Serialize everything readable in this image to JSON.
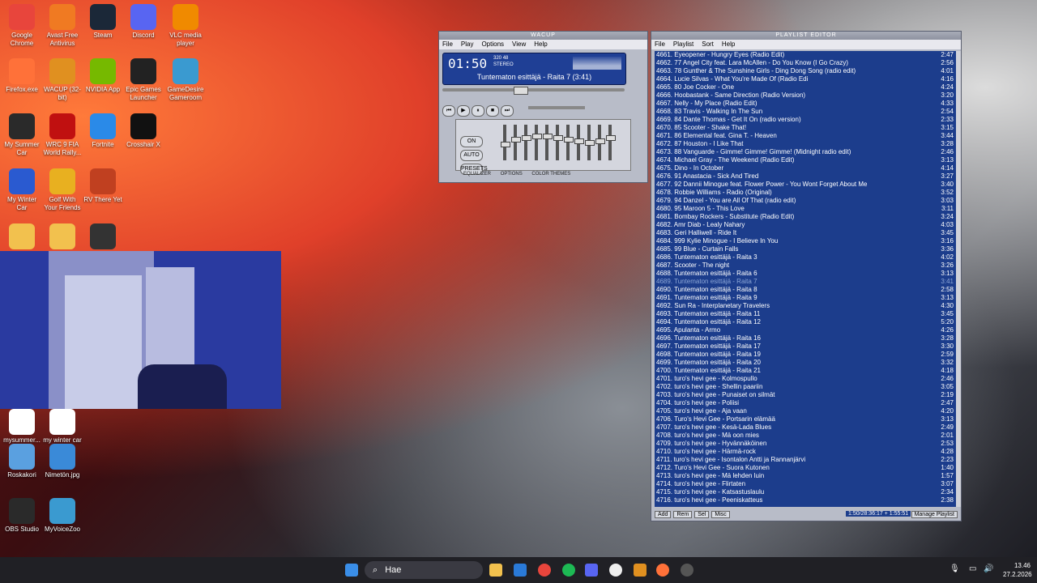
{
  "desktop": {
    "icons": [
      {
        "label": "Google Chrome",
        "icon": "chrome-icon",
        "color": "#e8453c"
      },
      {
        "label": "Avast Free Antivirus",
        "icon": "avast-icon",
        "color": "#f07a22"
      },
      {
        "label": "Steam",
        "icon": "steam-icon",
        "color": "#1b2838"
      },
      {
        "label": "Discord",
        "icon": "discord-icon",
        "color": "#5865f2"
      },
      {
        "label": "VLC media player",
        "icon": "vlc-icon",
        "color": "#f08a00"
      },
      {
        "label": "Firefox.exe",
        "icon": "firefox-icon",
        "color": "#ff7139"
      },
      {
        "label": "WACUP (32-bit)",
        "icon": "wacup-icon",
        "color": "#e09020"
      },
      {
        "label": "NVIDIA App",
        "icon": "nvidia-icon",
        "color": "#76b900"
      },
      {
        "label": "Epic Games Launcher",
        "icon": "epic-icon",
        "color": "#222222"
      },
      {
        "label": "GameDesire Gameroom",
        "icon": "gamedesire-icon",
        "color": "#3a9ad0"
      },
      {
        "label": "My Summer Car",
        "icon": "msc-icon",
        "color": "#2a2a2a"
      },
      {
        "label": "WRC 9 FIA World Rally...",
        "icon": "wrc-icon",
        "color": "#c01010"
      },
      {
        "label": "Fortnite",
        "icon": "fortnite-icon",
        "color": "#2a8ae8"
      },
      {
        "label": "Crosshair X",
        "icon": "crosshair-icon",
        "color": "#111111"
      },
      {
        "label": "My Winter Car",
        "icon": "mwc-icon",
        "color": "#2a5ad0"
      },
      {
        "label": "Golf With Your Friends",
        "icon": "golf-icon",
        "color": "#e8b020"
      },
      {
        "label": "RV There Yet",
        "icon": "rv-icon",
        "color": "#c04020"
      },
      {
        "label": "",
        "icon": "folder-icon",
        "color": "#f2c14e"
      },
      {
        "label": "",
        "icon": "folder-icon",
        "color": "#f2c14e"
      },
      {
        "label": "",
        "icon": "game-icon",
        "color": "#333333"
      },
      {
        "label": "mysummer...",
        "icon": "file-icon",
        "color": "#ffffff"
      },
      {
        "label": "my winter car save",
        "icon": "file-icon",
        "color": "#ffffff"
      },
      {
        "label": "Roskakori",
        "icon": "recycle-bin-icon",
        "color": "#5aa0e0"
      },
      {
        "label": "Nimetön.jpg",
        "icon": "image-file-icon",
        "color": "#3a8ad8"
      },
      {
        "label": "OBS Studio",
        "icon": "obs-icon",
        "color": "#2a2a2a"
      },
      {
        "label": "MyVoiceZoo",
        "icon": "myvoicezoo-icon",
        "color": "#3a9ad0"
      }
    ]
  },
  "player": {
    "title": "WACUP",
    "menu": [
      "File",
      "Play",
      "Options",
      "View",
      "Help"
    ],
    "time": "01:50",
    "kbps": "320",
    "khz": "48",
    "mode": "STEREO",
    "track_title": "Tuntematon esittäjä - Raita 7 (3:41)",
    "tabs": [
      "EQUALIZER",
      "OPTIONS",
      "COLOR THEMES"
    ],
    "eq_buttons": [
      "ON",
      "AUTO",
      "PRESETS"
    ],
    "eq_levels": [
      0.55,
      0.4,
      0.35,
      0.3,
      0.3,
      0.35,
      0.4,
      0.45,
      0.5,
      0.45,
      0.35
    ]
  },
  "playlist": {
    "title": "PLAYLIST EDITOR",
    "menu": [
      "File",
      "Playlist",
      "Sort",
      "Help"
    ],
    "rows": [
      {
        "t": "4661. Eyeopener - Hungry Eyes (Radio Edit)",
        "d": "2:47"
      },
      {
        "t": "4662. 77 Angel City feat. Lara McAllen - Do You Know (I Go Crazy)",
        "d": "2:56"
      },
      {
        "t": "4663. 78 Gunther & The Sunshine Girls - Ding Dong Song (radio edit)",
        "d": "4:01"
      },
      {
        "t": "4664. Lucie Silvas - What You're Made Of (Radio Edi",
        "d": "4:16"
      },
      {
        "t": "4665. 80 Joe Cocker - One",
        "d": "4:24"
      },
      {
        "t": "4666. Hoobastank - Same Direction (Radio Version)",
        "d": "3:20"
      },
      {
        "t": "4667. Nelly - My Place (Radio Edit)",
        "d": "4:33"
      },
      {
        "t": "4668. 83 Travis - Walking In The Sun",
        "d": "2:54"
      },
      {
        "t": "4669. 84 Dante Thomas - Get It On (radio version)",
        "d": "2:33"
      },
      {
        "t": "4670. 85 Scooter - Shake That!",
        "d": "3:15"
      },
      {
        "t": "4671. 86 Elemental feat. Gina T. - Heaven",
        "d": "3:44"
      },
      {
        "t": "4672. 87 Houston - I Like That",
        "d": "3:28"
      },
      {
        "t": "4673. 88 Vanguarde - Gimme! Gimme! Gimme! (Midnight radio edit)",
        "d": "2:46"
      },
      {
        "t": "4674. Michael Gray - The Weekend (Radio Edit)",
        "d": "3:13"
      },
      {
        "t": "4675. Dino - In October",
        "d": "4:14"
      },
      {
        "t": "4676. 91 Anastacia - Sick And Tired",
        "d": "3:27"
      },
      {
        "t": "4677. 92 Dannii Minogue feat. Flower Power - You Wont Forget About Me",
        "d": "3:40"
      },
      {
        "t": "4678. Robbie Williams - Radio (Original)",
        "d": "3:52"
      },
      {
        "t": "4679. 94 Danzel - You are All Of That (radio edit)",
        "d": "3:03"
      },
      {
        "t": "4680. 95 Maroon 5 - This Love",
        "d": "3:11"
      },
      {
        "t": "4681. Bombay Rockers - Substitute (Radio Edit)",
        "d": "3:24"
      },
      {
        "t": "4682. Amr Diab - Lealy Nahary",
        "d": "4:03"
      },
      {
        "t": "4683. Geri Halliwell - Ride It",
        "d": "3:45"
      },
      {
        "t": "4684. 999 Kylie Minogue - I Believe In You",
        "d": "3:16"
      },
      {
        "t": "4685. 99 Blue - Curtain Falls",
        "d": "3:36"
      },
      {
        "t": "4686. Tuntematon esittäjä - Raita 3",
        "d": "4:02"
      },
      {
        "t": "4687. Scooter - The night",
        "d": "3:26"
      },
      {
        "t": "4688. Tuntematon esittäjä - Raita 6",
        "d": "3:13"
      },
      {
        "t": "4689. Tuntematon esittäjä - Raita 7",
        "d": "3:41",
        "cur": true
      },
      {
        "t": "4690. Tuntematon esittäjä - Raita 8",
        "d": "2:58"
      },
      {
        "t": "4691. Tuntematon esittäjä - Raita 9",
        "d": "3:13"
      },
      {
        "t": "4692. Sun Ra - Interplanetary Travelers",
        "d": "4:30"
      },
      {
        "t": "4693. Tuntematon esittäjä - Raita 11",
        "d": "3:45"
      },
      {
        "t": "4694. Tuntematon esittäjä - Raita 12",
        "d": "5:20"
      },
      {
        "t": "4695. Apulanta - Armo",
        "d": "4:26"
      },
      {
        "t": "4696. Tuntematon esittäjä - Raita 16",
        "d": "3:28"
      },
      {
        "t": "4697. Tuntematon esittäjä - Raita 17",
        "d": "3:30"
      },
      {
        "t": "4698. Tuntematon esittäjä - Raita 19",
        "d": "2:59"
      },
      {
        "t": "4699. Tuntematon esittäjä - Raita 20",
        "d": "3:32"
      },
      {
        "t": "4700. Tuntematon esittäjä - Raita 21",
        "d": "4:18"
      },
      {
        "t": "4701. turo's hevi gee - Kolmospullo",
        "d": "2:46"
      },
      {
        "t": "4702. turo's hevi gee - Shellin paariin",
        "d": "3:05"
      },
      {
        "t": "4703. turo's hevi gee - Punaiset on silmät",
        "d": "2:19"
      },
      {
        "t": "4704. turo's hevi gee - Poliisi",
        "d": "2:47"
      },
      {
        "t": "4705. turo's hevi gee - Aja vaan",
        "d": "4:20"
      },
      {
        "t": "4706. Turo's Hevi Gee - Portsarin elämää",
        "d": "3:13"
      },
      {
        "t": "4707. turo's hevi gee - Kesä-Lada Blues",
        "d": "2:49"
      },
      {
        "t": "4708. turo's hevi gee - Mä oon mies",
        "d": "2:01"
      },
      {
        "t": "4709. turo's hevi gee - Hyvännäköinen",
        "d": "2:53"
      },
      {
        "t": "4710. turo's hevi gee - Härmä-rock",
        "d": "4:28"
      },
      {
        "t": "4711. turo's hevi gee - Isontalon Antti ja Rannanjärvi",
        "d": "2:23"
      },
      {
        "t": "4712. Turo's Hevi Gee - Suora Kutonen",
        "d": "1:40"
      },
      {
        "t": "4713. turo's hevi gee - Mä lehden luin",
        "d": "1:57"
      },
      {
        "t": "4714. turo's hevi gee - Flirtaten",
        "d": "3:07"
      },
      {
        "t": "4715. turo's hevi gee - Katsastuslaulu",
        "d": "2:34"
      },
      {
        "t": "4716. turo's hevi gee - Peeniskatteus",
        "d": "2:38"
      }
    ],
    "buttons": [
      "Add",
      "Rem",
      "Sel",
      "Misc"
    ],
    "total": "1:50/28:36:17 + 1:55:51",
    "manage": "Manage Playlist"
  },
  "taskbar": {
    "search_label": "Hae",
    "clock_time": "13.46",
    "clock_date": "27.2.2026"
  }
}
